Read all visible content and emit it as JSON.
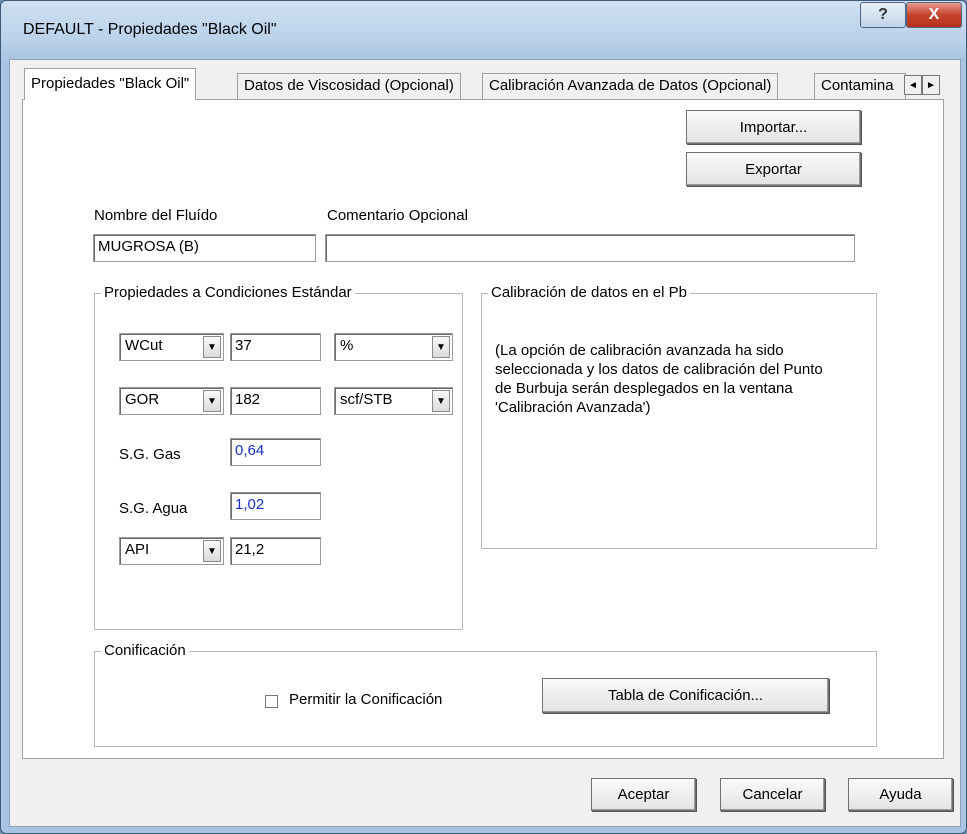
{
  "window": {
    "title": "DEFAULT - Propiedades \"Black Oil\"",
    "help_glyph": "?",
    "close_glyph": "X"
  },
  "tabs": [
    {
      "label": "Propiedades \"Black Oil\""
    },
    {
      "label": "Datos de Viscosidad (Opcional)"
    },
    {
      "label": "Calibración Avanzada de Datos (Opcional)"
    },
    {
      "label": "Contamina"
    }
  ],
  "tab_scroll": {
    "left": "◄",
    "right": "►"
  },
  "actions": {
    "import_label": "Importar...",
    "export_label": "Exportar"
  },
  "fluid": {
    "name_label": "Nombre del Fluído",
    "name_value": "MUGROSA (B)",
    "comment_label": "Comentario Opcional",
    "comment_value": ""
  },
  "std_props": {
    "legend": "Propiedades a Condiciones Estándar",
    "wcut": {
      "selector": "WCut",
      "value": "37",
      "unit": "%"
    },
    "gor": {
      "selector": "GOR",
      "value": "182",
      "unit": "scf/STB"
    },
    "sg_gas": {
      "label": "S.G. Gas",
      "value": "0,64"
    },
    "sg_agua": {
      "label": "S.G. Agua",
      "value": "1,02"
    },
    "api": {
      "selector": "API",
      "value": "21,2"
    },
    "dropdown_glyph": "▼"
  },
  "calibration": {
    "legend": "Calibración de datos en el Pb",
    "text_lines": [
      "(La opción de calibración avanzada ha sido",
      "seleccionada y los datos de calibración del Punto",
      "de Burbuja serán desplegados en la ventana",
      "'Calibración Avanzada')"
    ]
  },
  "coning": {
    "legend": "Conificación",
    "checkbox_label": "Permitir la Conificación",
    "checked": false,
    "table_button": "Tabla de Conificación..."
  },
  "footer": {
    "accept": "Aceptar",
    "cancel": "Cancelar",
    "help": "Ayuda"
  }
}
